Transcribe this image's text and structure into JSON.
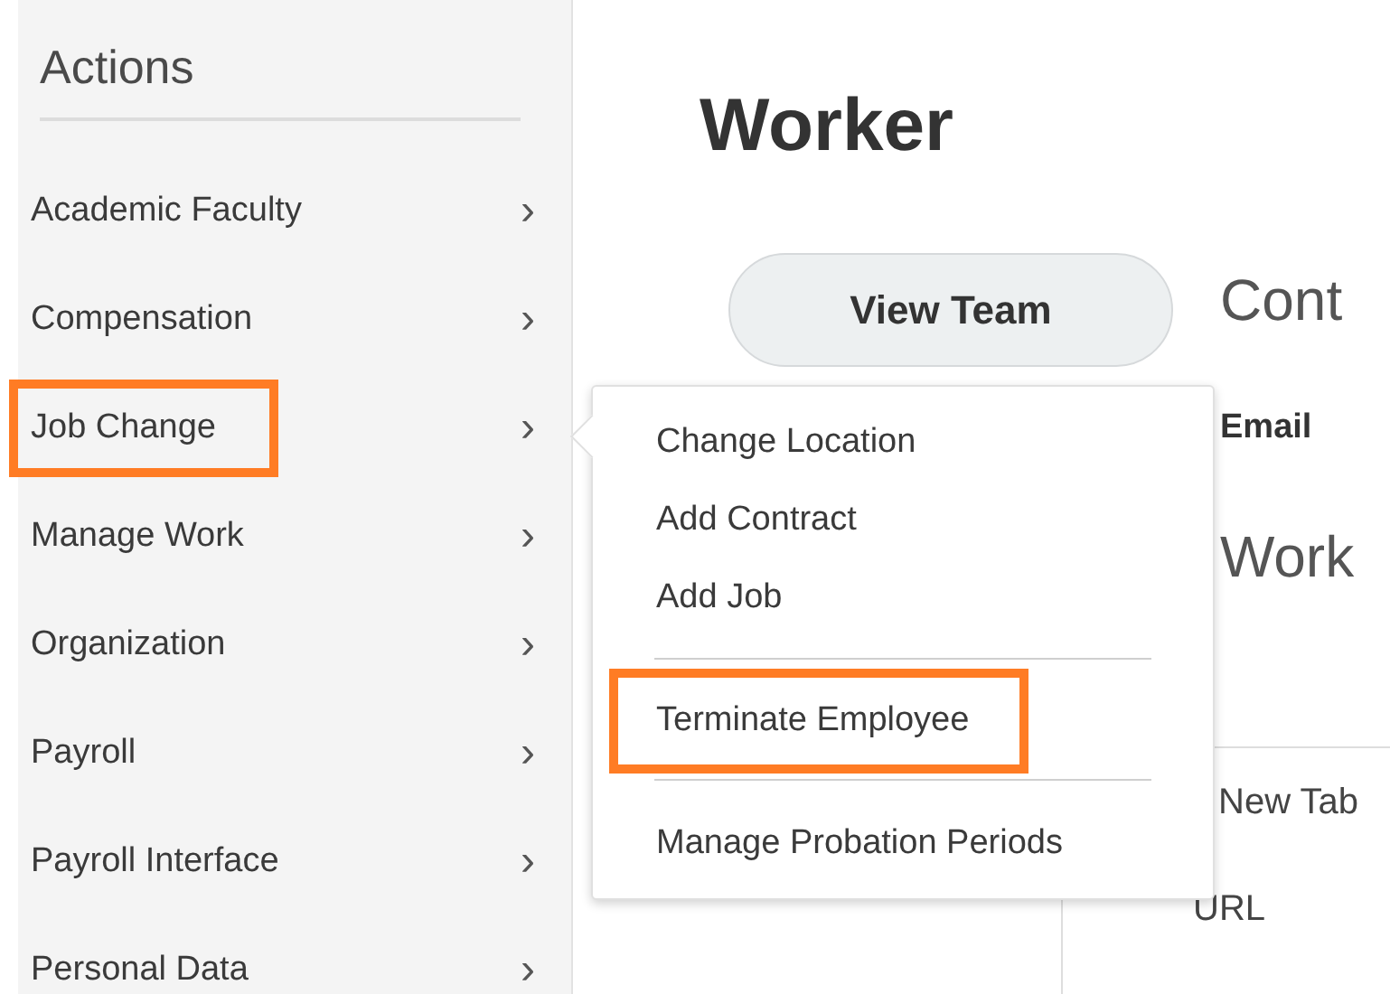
{
  "sidebar": {
    "title": "Actions",
    "items": [
      {
        "label": "Academic Faculty",
        "chevron": "›",
        "highlighted": false
      },
      {
        "label": "Compensation",
        "chevron": "›",
        "highlighted": false
      },
      {
        "label": "Job Change",
        "chevron": "›",
        "highlighted": true
      },
      {
        "label": "Manage Work",
        "chevron": "›",
        "highlighted": false
      },
      {
        "label": "Organization",
        "chevron": "›",
        "highlighted": false
      },
      {
        "label": "Payroll",
        "chevron": "›",
        "highlighted": false
      },
      {
        "label": "Payroll Interface",
        "chevron": "›",
        "highlighted": false
      },
      {
        "label": "Personal Data",
        "chevron": "›",
        "highlighted": false
      }
    ]
  },
  "main": {
    "title": "Worker",
    "button": "View Team",
    "contact_heading": "Cont",
    "email_label": "Email",
    "work_heading": "Work"
  },
  "context_menu": {
    "items": [
      "New Tab",
      "URL"
    ]
  },
  "submenu": {
    "groups": [
      [
        {
          "label": "Change Location",
          "highlighted": false
        },
        {
          "label": "Add Contract",
          "highlighted": false
        },
        {
          "label": "Add Job",
          "highlighted": false
        }
      ],
      [
        {
          "label": "Terminate Employee",
          "highlighted": true
        }
      ],
      [
        {
          "label": "Manage Probation Periods",
          "highlighted": false
        }
      ]
    ]
  }
}
